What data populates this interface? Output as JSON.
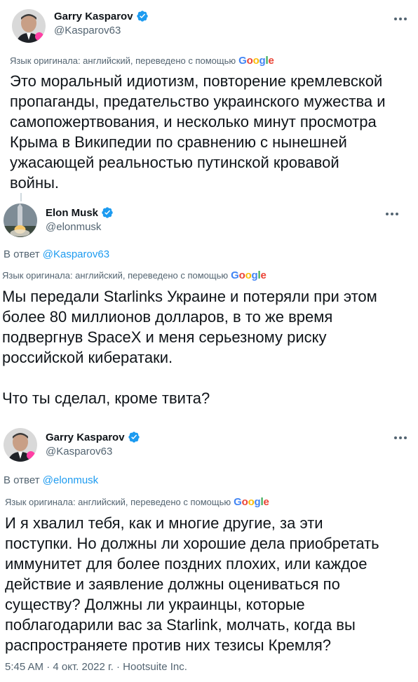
{
  "tweets": [
    {
      "author": {
        "name": "Garry Kasparov",
        "handle": "@Kasparov63",
        "verified": true,
        "avatar_icon": "kasparov-portrait"
      },
      "translation_note": "Язык оригинала: английский, переведено с помощью",
      "translation_provider": "Google",
      "text": "Это моральный идиотизм, повторение кремлевской\nпропаганды, предательство украинского мужества и\nсамопожертвования, и несколько минут просмотра\nКрыма в Википедии по сравнению с нынешней\nужасающей реальностью путинской кровавой\nвойны."
    },
    {
      "author": {
        "name": "Elon Musk",
        "handle": "@elonmusk",
        "verified": true,
        "avatar_icon": "rocket-launch-photo"
      },
      "reply_prefix": "В ответ",
      "reply_to": "@Kasparov63",
      "translation_note": "Язык оригинала: английский, переведено с помощью",
      "translation_provider": "Google",
      "text": "Мы передали Starlinks Украине и потеряли при этом\nболее 80 миллионов долларов, в то же время\nподвергнув SpaceX и меня серьезному риску\nроссийской кибератаки.\n\nЧто ты сделал, кроме твита?"
    },
    {
      "author": {
        "name": "Garry Kasparov",
        "handle": "@Kasparov63",
        "verified": true,
        "avatar_icon": "kasparov-portrait"
      },
      "reply_prefix": "В ответ",
      "reply_to": "@elonmusk",
      "translation_note": "Язык оригинала: английский, переведено с помощью",
      "translation_provider": "Google",
      "text": "И я хвалил тебя, как и многие другие, за эти\nпоступки. Но должны ли хорошие дела приобретать\nиммунитет для более поздних плохих, или каждое\nдействие и заявление должны оцениваться по\nсуществу? Должны ли украинцы, которые\nпоблагодарили вас за Starlink, молчать, когда вы\nраспространяете против них тезисы Кремля?",
      "timestamp": "5:45 AM · 4 окт. 2022 г. · Hootsuite Inc."
    }
  ],
  "colors": {
    "text": "#0f1419",
    "secondary": "#536471",
    "link": "#1d9bf0",
    "verified": "#1d9bf0",
    "connector": "#cfd9de"
  },
  "icons": {
    "verified": "verified-badge-icon",
    "more": "more-options-icon"
  }
}
